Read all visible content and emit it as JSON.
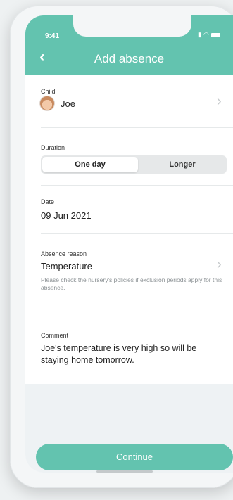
{
  "status_bar": {
    "time": "9:41"
  },
  "header": {
    "title": "Add absence",
    "back_icon": "chevron-left-icon"
  },
  "child": {
    "label": "Child",
    "name": "Joe"
  },
  "duration": {
    "label": "Duration",
    "options": [
      "One day",
      "Longer"
    ],
    "selected": "One day"
  },
  "date": {
    "label": "Date",
    "value": "09 Jun 2021"
  },
  "absence_reason": {
    "label": "Absence reason",
    "value": "Temperature",
    "note": "Please check the nursery's policies if exclusion periods apply for this absence."
  },
  "comment": {
    "label": "Comment",
    "value": "Joe's temperature is very high so will be staying home tomorrow."
  },
  "footer": {
    "continue_label": "Continue"
  },
  "colors": {
    "accent": "#63c3af"
  }
}
